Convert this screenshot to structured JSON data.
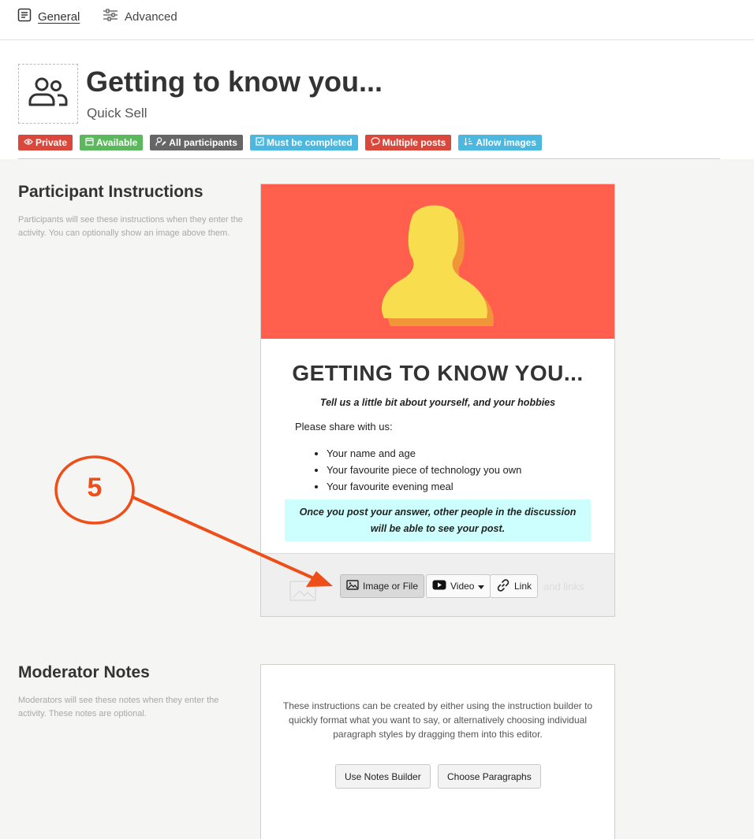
{
  "tabs": [
    {
      "label": "General",
      "icon": "document-icon",
      "active": true
    },
    {
      "label": "Advanced",
      "icon": "sliders-icon",
      "active": false
    }
  ],
  "header": {
    "title": "Getting to know you...",
    "subtitle": "Quick Sell",
    "avatar_icon": "users-icon"
  },
  "badges": [
    {
      "label": "Private",
      "icon": "eye-icon",
      "color": "#d9483b"
    },
    {
      "label": "Available",
      "icon": "calendar-icon",
      "color": "#5cb85c"
    },
    {
      "label": "All participants",
      "icon": "user-edit-icon",
      "color": "#666666"
    },
    {
      "label": "Must be completed",
      "icon": "checkbox-icon",
      "color": "#4cb7df"
    },
    {
      "label": "Multiple posts",
      "icon": "speech-bubble-icon",
      "color": "#d9483b"
    },
    {
      "label": "Allow images",
      "icon": "sort-icon",
      "color": "#4cb7df"
    }
  ],
  "participant_section": {
    "title": "Participant Instructions",
    "description": "Participants will see these instructions when they enter the activity. You can optionally show an image above them."
  },
  "instructions_card": {
    "hero_color": "#ff5f4c",
    "heading": "GETTING TO KNOW YOU...",
    "tagline": "Tell us a little bit about yourself, and your hobbies",
    "intro": "Please share with us:",
    "items": [
      "Your name and age",
      "Your favourite piece of technology you own",
      "Your favourite evening meal"
    ],
    "notice": "Once you post your answer, other people in the discussion will be able to see your post.",
    "toolbar": {
      "image_button": "Image or File",
      "video_button": "Video",
      "link_button": "Link",
      "ghost_text": "and links"
    }
  },
  "moderator_section": {
    "title": "Moderator Notes",
    "description": "Moderators will see these notes when they enter the activity. These notes are optional."
  },
  "notes_card": {
    "text": "These instructions can be created by either using the instruction builder to quickly format what you want to say, or alternatively choosing individual paragraph styles by dragging them into this editor.",
    "builder_button": "Use Notes Builder",
    "paragraphs_button": "Choose Paragraphs"
  },
  "annotation": {
    "step_number": "5",
    "color": "#ee4e18"
  }
}
